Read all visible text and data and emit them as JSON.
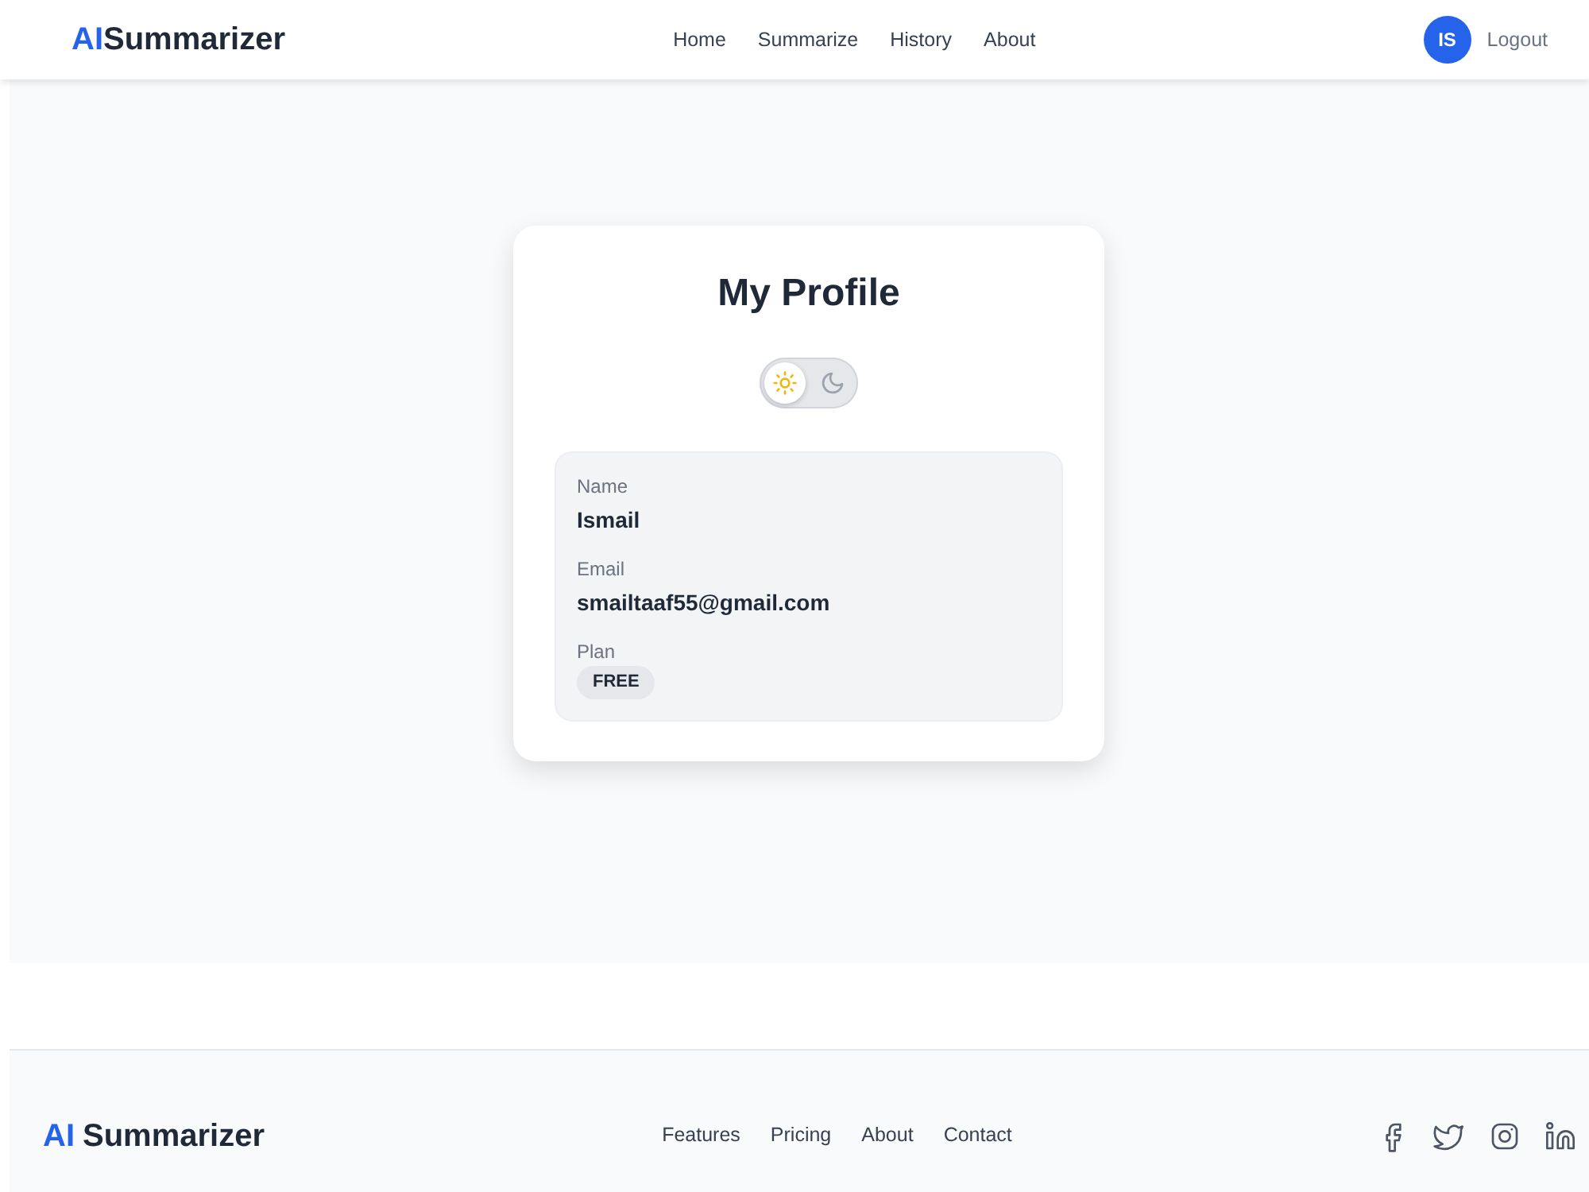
{
  "header": {
    "logo": {
      "accent": "AI",
      "text": "Summarizer"
    },
    "nav": [
      {
        "label": "Home"
      },
      {
        "label": "Summarize"
      },
      {
        "label": "History"
      },
      {
        "label": "About"
      }
    ],
    "avatar": "IS",
    "logout": "Logout"
  },
  "profile": {
    "title": "My Profile",
    "theme_toggle": [
      {
        "kind": "light",
        "selected": true
      },
      {
        "kind": "dark",
        "selected": false
      }
    ],
    "fields": [
      {
        "kind": "text",
        "label": "Name",
        "value": "Ismail"
      },
      {
        "kind": "text",
        "label": "Email",
        "value": "smailtaaf55@gmail.com"
      },
      {
        "kind": "badge",
        "label": "Plan",
        "value": "FREE"
      }
    ]
  },
  "footer": {
    "logo": {
      "accent": "AI",
      "text": "Summarizer"
    },
    "links": [
      {
        "label": "Features"
      },
      {
        "label": "Pricing"
      },
      {
        "label": "About"
      },
      {
        "label": "Contact"
      }
    ]
  }
}
